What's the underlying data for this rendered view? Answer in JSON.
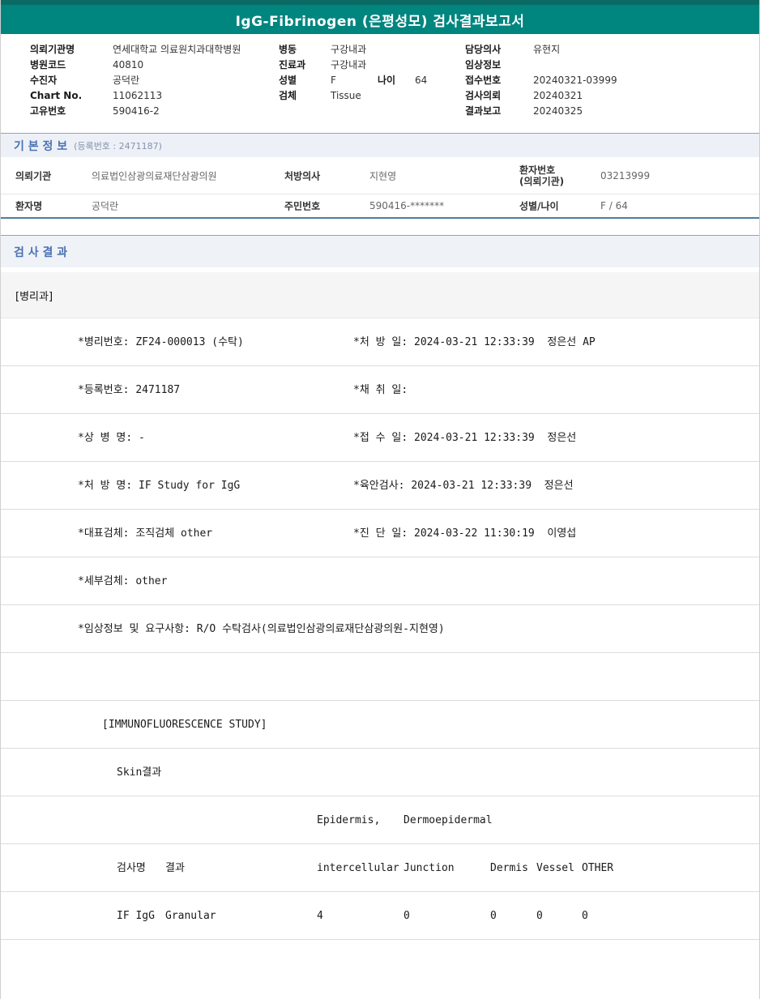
{
  "title": "IgG-Fibrinogen (은평성모) 검사결과보고서",
  "header": {
    "col1": [
      {
        "label": "의뢰기관명",
        "value": "연세대학교 의료원치과대학병원"
      },
      {
        "label": "병원코드",
        "value": "40810"
      },
      {
        "label": "수진자",
        "value": "공덕란"
      },
      {
        "label": "Chart No.",
        "value": "11062113"
      },
      {
        "label": "고유번호",
        "value": "590416-2"
      }
    ],
    "col2": [
      {
        "label": "병동",
        "value": "구강내과"
      },
      {
        "label": "진료과",
        "value": "구강내과"
      },
      {
        "label": "성별",
        "value": "F",
        "label2": "나이",
        "value2": "64"
      },
      {
        "label": "검체",
        "value": "Tissue"
      }
    ],
    "col3": [
      {
        "label": "담당의사",
        "value": "유현지"
      },
      {
        "label": "임상정보",
        "value": ""
      },
      {
        "label": "접수번호",
        "value": "20240321-03999"
      },
      {
        "label": "검사의뢰",
        "value": "20240321"
      },
      {
        "label": "결과보고",
        "value": "20240325"
      }
    ]
  },
  "basic_info": {
    "heading": "기 본 정 보",
    "reg_no": "(등록번호 : 2471187)",
    "rows": [
      {
        "l1": "의뢰기관",
        "v1": "의료법인삼광의료재단삼광의원",
        "l2": "처방의사",
        "v2": "지현영",
        "l3": "환자번호",
        "l3b": "(의뢰기관)",
        "v3": "03213999"
      },
      {
        "l1": "환자명",
        "v1": "공덕란",
        "l2": "주민번호",
        "v2": "590416-*******",
        "l3": "성별/나이",
        "l3b": "",
        "v3": "F / 64"
      }
    ]
  },
  "results": {
    "heading": "검 사 결 과",
    "department": "[병리과]",
    "details": [
      {
        "left": "*병리번호: ZF24-000013 (수탁)",
        "right": "*처 방 일: 2024-03-21 12:33:39  정은선 AP"
      },
      {
        "left": "*등록번호: 2471187",
        "right": "*채 취 일:"
      },
      {
        "left": "*상 병 명: -",
        "right": "*접 수 일: 2024-03-21 12:33:39  정은선"
      },
      {
        "left": "*처 방 명: IF Study for IgG",
        "right": "*육안검사: 2024-03-21 12:33:39  정은선"
      },
      {
        "left": "*대표검체: 조직검체 other",
        "right": "*진 단 일: 2024-03-22 11:30:19  이영섭"
      },
      {
        "left": "*세부검체: other",
        "right": ""
      },
      {
        "left": "*임상정보 및 요구사항: R/O 수탁검사(의료법인삼광의료재단삼광의원-지현영)",
        "right": ""
      }
    ],
    "study_title": "[IMMUNOFLUORESCENCE STUDY]",
    "skin_result": "Skin결과",
    "table": {
      "header1": {
        "epidermis": "Epidermis,",
        "dermoepidermal": "Dermoepidermal"
      },
      "header2": {
        "test": "검사명",
        "result": "결과",
        "intercellular": "intercellular",
        "junction": "Junction",
        "dermis": "Dermis",
        "vessel": "Vessel",
        "other": "OTHER"
      },
      "row": {
        "test": "IF IgG",
        "result": "Granular",
        "intercellular": "4",
        "junction": "0",
        "dermis": "0",
        "vessel": "0",
        "other": "0"
      }
    }
  }
}
